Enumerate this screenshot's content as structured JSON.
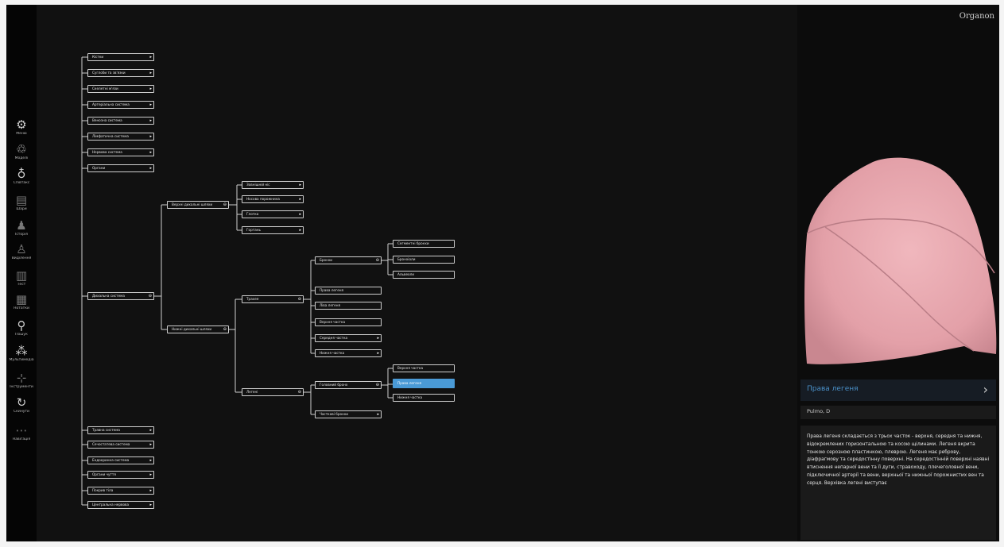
{
  "app": {
    "logo": "Organon"
  },
  "sidebar": {
    "items": [
      {
        "label": "Меню",
        "icon": "gear-icon",
        "glyph": "⚙"
      },
      {
        "label": "Моделі",
        "icon": "models-icon",
        "glyph": "♲"
      },
      {
        "label": "Співтакс",
        "icon": "flask-icon",
        "glyph": "♁"
      },
      {
        "label": "Шари",
        "icon": "layers-icon",
        "glyph": "▤"
      },
      {
        "label": "Історія",
        "icon": "person-icon",
        "glyph": "♟"
      },
      {
        "label": "Виділення",
        "icon": "figure-icon",
        "glyph": "♙"
      },
      {
        "label": "Тест",
        "icon": "document-icon",
        "glyph": "▥"
      },
      {
        "label": "Нотатки",
        "icon": "notes-icon",
        "glyph": "▦"
      },
      {
        "label": "Пошук",
        "icon": "search-icon",
        "glyph": "⚲"
      },
      {
        "label": "Мультимедіа",
        "icon": "multimedia-icon",
        "glyph": "⁂"
      },
      {
        "label": "Інструменти",
        "icon": "tools-icon",
        "glyph": "⊹"
      },
      {
        "label": "Скинути",
        "icon": "reset-icon",
        "glyph": "↻"
      },
      {
        "label": "Навігація",
        "icon": "navigation-icon",
        "glyph": "⋯"
      }
    ]
  },
  "tree": {
    "nodes": {
      "n1": "Кістки",
      "n2": "Суглоби та зв'язки",
      "n3": "Скелетні м'язи",
      "n4": "Артеріальна система",
      "n5": "Венозна система",
      "n6": "Лімфатична система",
      "n7": "Нервова система",
      "n8": "Органи",
      "n9": "Дихальна система",
      "n10": "Травна система",
      "n11": "Сечостатева система",
      "n12": "Ендокринна система",
      "n13": "Органи чуття",
      "n14": "Покрив тіла",
      "n15": "Центральна нервова",
      "n16": "Верхні дихальні шляхи",
      "n17": "Нижні дихальні шляхи",
      "n18": "Зовнішній ніс",
      "n19": "Носова порожнина",
      "n20": "Глотка",
      "n21": "Гортань",
      "n22": "Трахея",
      "n23": "Легені",
      "n24": "Бронхи",
      "n25": "Права легеня",
      "n26": "Ліва легеня",
      "n27": "Верхня частка",
      "n28": "Середня частка",
      "n29": "Нижня частка",
      "n30": "Головний бронх",
      "n31": "Часткові бронхи",
      "n32": "Сегментні бронхи",
      "n33": "Бронхіоли",
      "n34": "Альвеоли",
      "n35": "Верхня частка",
      "n36": "Права легеня",
      "n37": "Нижня частка"
    },
    "selected": "n36"
  },
  "detail": {
    "image": "Права легеня",
    "title": "Права легеня",
    "lang": "Pulmo, D",
    "description": "Права легеня складається з трьох часток - верхня, середня та нижня, відокремлених горизонтальною та косою щілинами. Легеня вкрита тонкою серозною пластинкою, плеврою. Легеня має реброву, діафрагмову та середостінну поверхні. На середостінній поверхні наявні втиснення непарної вени та її дуги, стравоходу, плечеголовної вени, підключичної артерії та вени, верхньої та нижньої порожнистих вен та серця. Верхівка легені виступає"
  },
  "colors": {
    "accent": "#4a9ad6",
    "title": "#4a90c8",
    "background": "#111111",
    "lung": "#e8aab0"
  }
}
